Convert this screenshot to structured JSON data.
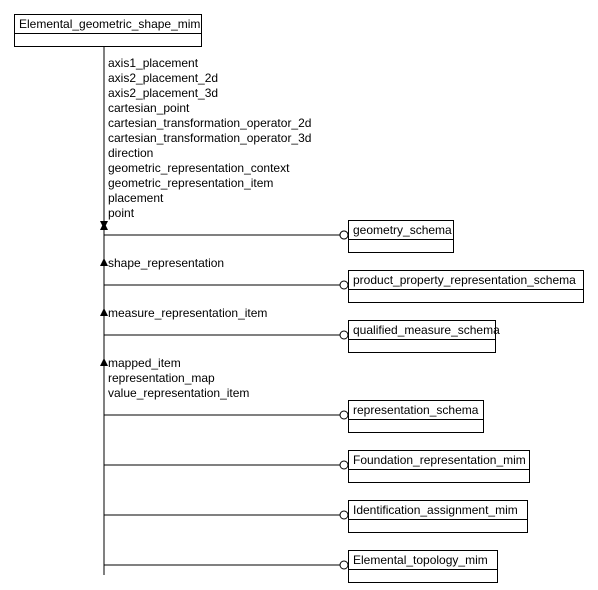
{
  "main_schema": "Elemental_geometric_shape_mim",
  "groups": [
    {
      "attrs": [
        "axis1_placement",
        "axis2_placement_2d",
        "axis2_placement_3d",
        "cartesian_point",
        "cartesian_transformation_operator_2d",
        "cartesian_transformation_operator_3d",
        "direction",
        "geometric_representation_context",
        "geometric_representation_item",
        "placement",
        "point"
      ],
      "target": "geometry_schema"
    },
    {
      "attrs": [
        "shape_representation"
      ],
      "target": "product_property_representation_schema"
    },
    {
      "attrs": [
        "measure_representation_item"
      ],
      "target": "qualified_measure_schema"
    },
    {
      "attrs": [
        "mapped_item",
        "representation_map",
        "value_representation_item"
      ],
      "target": "representation_schema"
    },
    {
      "attrs": [],
      "target": "Foundation_representation_mim"
    },
    {
      "attrs": [],
      "target": "Identification_assignment_mim"
    },
    {
      "attrs": [],
      "target": "Elemental_topology_mim"
    }
  ]
}
